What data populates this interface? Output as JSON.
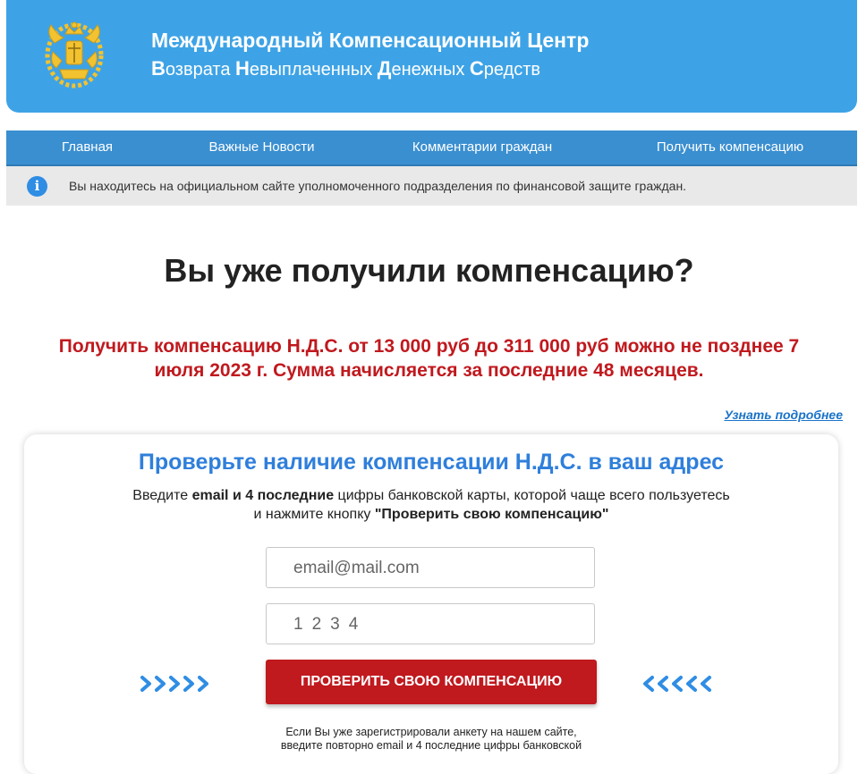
{
  "header": {
    "title_line1": "Международный Компенсационный Центр",
    "title_line2": [
      {
        "cap": "В",
        "rest": "озврата "
      },
      {
        "cap": "Н",
        "rest": "евыплаченных "
      },
      {
        "cap": "Д",
        "rest": "енежных "
      },
      {
        "cap": "С",
        "rest": "редств"
      }
    ],
    "logo_icon": "emblem-icon"
  },
  "nav": [
    {
      "label": "Главная"
    },
    {
      "label": "Важные Новости"
    },
    {
      "label": "Комментарии граждан"
    },
    {
      "label": "Получить компенсацию"
    }
  ],
  "info": {
    "icon": "info-icon",
    "text": "Вы находитесь на официальном сайте уполномоченного подразделения по финансовой защите граждан."
  },
  "main": {
    "heading": "Вы уже получили компенсацию?",
    "red_text_line1": "Получить компенсацию Н.Д.С. от 13 000 руб до 311 000 руб можно не позднее 7",
    "red_text_line2": "июля 2023 г. Сумма начисляется за последние 48 месяцев.",
    "more_link": "Узнать подробнее"
  },
  "card": {
    "title": "Проверьте наличие компенсации Н.Д.С. в ваш адрес",
    "instr_pre": "Введите ",
    "instr_bold1": "email и 4 последние",
    "instr_mid": " цифры банковской карты, которой чаще всего пользуетесь",
    "instr_line2_pre": "и нажмите кнопку ",
    "instr_bold2": "\"Проверить свою компенсацию\"",
    "email_placeholder": "email@mail.com",
    "card_placeholder": "1234",
    "button_label": "ПРОВЕРИТЬ СВОЮ КОМПЕНСАЦИЮ",
    "note_line1": "Если Вы уже зарегистрировали анкету на нашем сайте,",
    "note_line2": "введите повторно email и 4 последние цифры банковской"
  },
  "colors": {
    "header_bg": "#3ea3e6",
    "nav_bg": "#3a8fd0",
    "accent_red": "#c0191e",
    "accent_blue": "#2f7fdb"
  }
}
